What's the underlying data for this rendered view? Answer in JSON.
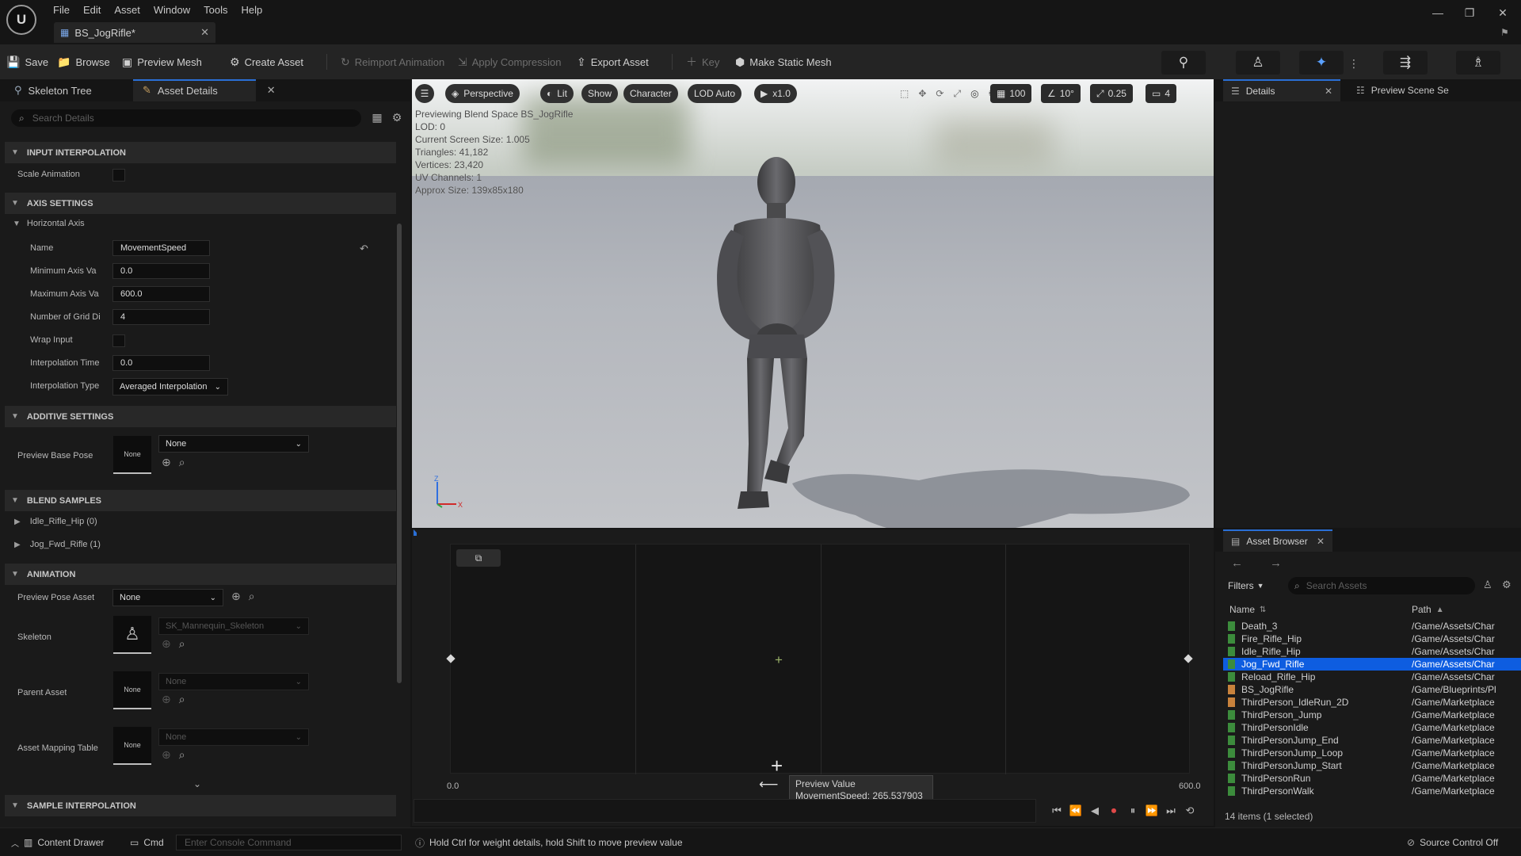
{
  "app": {
    "logo": "U",
    "menu": [
      "File",
      "Edit",
      "Asset",
      "Window",
      "Tools",
      "Help"
    ],
    "doc_tab": "BS_JogRifle*",
    "window_buttons": [
      "minimize-icon",
      "restore-icon",
      "close-icon"
    ]
  },
  "toolbar": {
    "save": "Save",
    "browse": "Browse",
    "preview_mesh": "Preview Mesh",
    "create_asset": "Create Asset",
    "reimport_animation": "Reimport Animation",
    "apply_compression": "Apply Compression",
    "export_asset": "Export Asset",
    "key": "Key",
    "make_static_mesh": "Make Static Mesh"
  },
  "left_panel": {
    "tabs": [
      "Skeleton Tree",
      "Asset Details"
    ],
    "search_placeholder": "Search Details",
    "sections": {
      "input_interpolation": "INPUT INTERPOLATION",
      "axis_settings": "AXIS SETTINGS",
      "additive_settings": "ADDITIVE SETTINGS",
      "blend_samples": "BLEND SAMPLES",
      "animation": "ANIMATION",
      "sample_interpolation": "SAMPLE INTERPOLATION"
    },
    "scale_animation": "Scale Animation",
    "horizontal_axis": "Horizontal Axis",
    "props": [
      {
        "label": "Name",
        "value": "MovementSpeed"
      },
      {
        "label": "Minimum Axis Va",
        "value": "0.0"
      },
      {
        "label": "Maximum Axis Va",
        "value": "600.0"
      },
      {
        "label": "Number of Grid Di",
        "value": "4"
      },
      {
        "label": "Wrap Input",
        "value": ""
      },
      {
        "label": "Interpolation Time",
        "value": "0.0"
      },
      {
        "label": "Interpolation Type",
        "value": "Averaged Interpolation"
      }
    ],
    "preview_base_pose": "Preview Base Pose",
    "none": "None",
    "blend_samples": [
      "Idle_Rifle_Hip (0)",
      "Jog_Fwd_Rifle (1)"
    ],
    "preview_pose_asset": "Preview Pose Asset",
    "skeleton": "Skeleton",
    "skeleton_value": "SK_Mannequin_Skeleton",
    "parent_asset": "Parent Asset",
    "asset_mapping_table": "Asset Mapping Table"
  },
  "viewport": {
    "buttons": [
      "Perspective",
      "Lit",
      "Show",
      "Character",
      "LOD Auto",
      "x1.0"
    ],
    "grid_snap": "100",
    "rot_snap": "10°",
    "scale_snap": "0.25",
    "cam_speed": "4",
    "info": [
      "Previewing Blend Space BS_JogRifle",
      "LOD: 0",
      "Current Screen Size: 1.005",
      "Triangles: 41,182",
      "Vertices: 23,420",
      "UV Channels: 1",
      "Approx Size: 139x85x180"
    ],
    "axis_z": "Z",
    "axis_x": "X"
  },
  "graph": {
    "min_label": "0.0",
    "max_label": "600.0",
    "tooltip_title": "Preview Value",
    "tooltip_value": "MovementSpeed: 265.537903"
  },
  "details_panel": {
    "tabs": [
      "Details",
      "Preview Scene Se"
    ]
  },
  "asset_browser": {
    "tab": "Asset Browser",
    "filters": "Filters",
    "search_placeholder": "Search Assets",
    "col_name": "Name",
    "col_path": "Path",
    "items": [
      {
        "name": "Death_3",
        "path": "/Game/Assets/Char",
        "color": "#3c8c3c"
      },
      {
        "name": "Fire_Rifle_Hip",
        "path": "/Game/Assets/Char",
        "color": "#3c8c3c"
      },
      {
        "name": "Idle_Rifle_Hip",
        "path": "/Game/Assets/Char",
        "color": "#3c8c3c"
      },
      {
        "name": "Jog_Fwd_Rifle",
        "path": "/Game/Assets/Char",
        "color": "#3c8c3c"
      },
      {
        "name": "Reload_Rifle_Hip",
        "path": "/Game/Assets/Char",
        "color": "#3c8c3c"
      },
      {
        "name": "BS_JogRifle",
        "path": "/Game/Blueprints/Pl",
        "color": "#c8823c"
      },
      {
        "name": "ThirdPerson_IdleRun_2D",
        "path": "/Game/Marketplace",
        "color": "#c8823c"
      },
      {
        "name": "ThirdPerson_Jump",
        "path": "/Game/Marketplace",
        "color": "#3c8c3c"
      },
      {
        "name": "ThirdPersonIdle",
        "path": "/Game/Marketplace",
        "color": "#3c8c3c"
      },
      {
        "name": "ThirdPersonJump_End",
        "path": "/Game/Marketplace",
        "color": "#3c8c3c"
      },
      {
        "name": "ThirdPersonJump_Loop",
        "path": "/Game/Marketplace",
        "color": "#3c8c3c"
      },
      {
        "name": "ThirdPersonJump_Start",
        "path": "/Game/Marketplace",
        "color": "#3c8c3c"
      },
      {
        "name": "ThirdPersonRun",
        "path": "/Game/Marketplace",
        "color": "#3c8c3c"
      },
      {
        "name": "ThirdPersonWalk",
        "path": "/Game/Marketplace",
        "color": "#3c8c3c"
      }
    ],
    "selected": "Jog_Fwd_Rifle",
    "count": "14 items (1 selected)"
  },
  "status": {
    "content_drawer": "Content Drawer",
    "cmd": "Cmd",
    "console_placeholder": "Enter Console Command",
    "hint": "Hold Ctrl for weight details, hold Shift to move preview value",
    "source_control": "Source Control Off"
  },
  "colors": {
    "accent": "#0e5de0",
    "panel": "#1a1a1a",
    "toolbar": "#242424"
  }
}
